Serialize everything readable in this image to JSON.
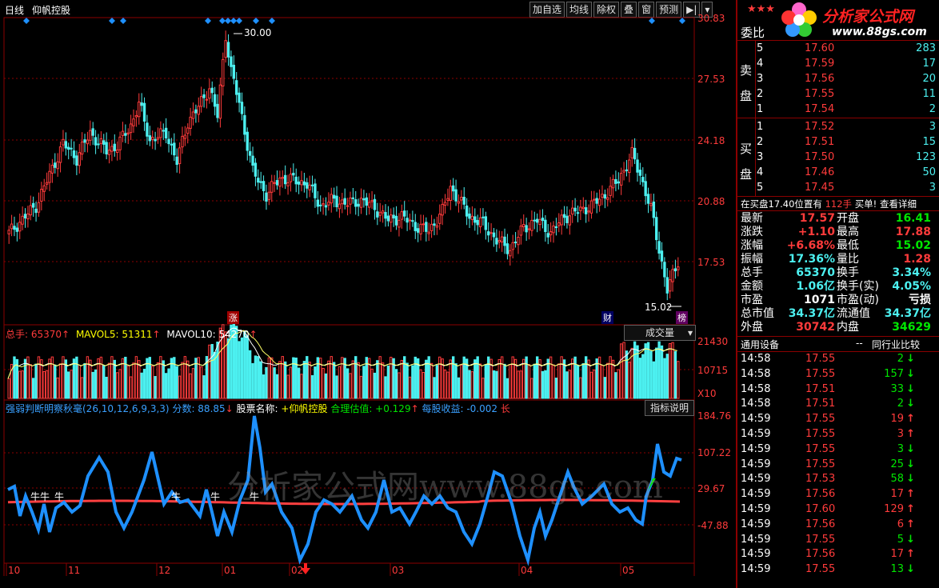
{
  "header": {
    "period_tab": "日线",
    "stock_name": "仰帆控股",
    "buttons": [
      "加自选",
      "均线",
      "除权",
      "叠",
      "窗",
      "预测"
    ],
    "brand_text": "分析家公式网",
    "brand_url": "www.88gs.com"
  },
  "price_chart": {
    "y_ticks": [
      "30.83",
      "27.53",
      "24.18",
      "20.88",
      "17.53"
    ],
    "high_label": "30.00",
    "low_label": "15.02",
    "markers": [
      "涨",
      "财",
      "榜"
    ]
  },
  "volume_panel": {
    "label_total": "总手: 65370",
    "label_ma5": "MAVOL5: 51311",
    "label_ma10": "MAVOL10: 54270",
    "dropdown": "成交量",
    "y_ticks": [
      "21430",
      "10715",
      "X10"
    ]
  },
  "indicator_panel": {
    "title": "强弱判断明察秋毫(26,10,12,6,9,3,3)",
    "score": "分数: 88.85",
    "stock_name_label": "股票名称:",
    "stock_name_value": "+仰帆控股",
    "fair_value": "合理估值: +0.129",
    "eps": "每股收益: -0.002",
    "suffix": "长",
    "button": "指标说明",
    "y_ticks": [
      "184.76",
      "107.22",
      "29.67",
      "-47.88"
    ],
    "watermark": "分析家公式网www.88gs.com",
    "niu_labels": [
      "牛牛",
      "牛",
      "牛",
      "牛",
      "牛"
    ]
  },
  "x_axis": [
    "10",
    "11",
    "12",
    "01",
    "02",
    "03",
    "04",
    "05"
  ],
  "order_book": {
    "title": "委比",
    "sell_label": "卖盘",
    "buy_label": "买盘",
    "sell": [
      {
        "level": "5",
        "price": "17.60",
        "vol": "283"
      },
      {
        "level": "4",
        "price": "17.59",
        "vol": "17"
      },
      {
        "level": "3",
        "price": "17.56",
        "vol": "20"
      },
      {
        "level": "2",
        "price": "17.55",
        "vol": "11"
      },
      {
        "level": "1",
        "price": "17.54",
        "vol": "2"
      }
    ],
    "buy": [
      {
        "level": "1",
        "price": "17.52",
        "vol": "3"
      },
      {
        "level": "2",
        "price": "17.51",
        "vol": "15"
      },
      {
        "level": "3",
        "price": "17.50",
        "vol": "123"
      },
      {
        "level": "4",
        "price": "17.46",
        "vol": "50"
      },
      {
        "level": "5",
        "price": "17.45",
        "vol": "3"
      }
    ],
    "notice_left": "在买盘17.40位置有",
    "notice_qty": "112手",
    "notice_right": "买单! 查看详细"
  },
  "quote": [
    {
      "l1": "最新",
      "v1": "17.57",
      "l2": "开盘",
      "v2": "16.41"
    },
    {
      "l1": "涨跌",
      "v1": "+1.10",
      "l2": "最高",
      "v2": "17.88"
    },
    {
      "l1": "涨幅",
      "v1": "+6.68%",
      "l2": "最低",
      "v2": "15.02"
    },
    {
      "l1": "振幅",
      "v1": "17.36%",
      "l2": "量比",
      "v2": "1.28"
    },
    {
      "l1": "总手",
      "v1": "65370",
      "l2": "换手",
      "v2": "3.34%"
    },
    {
      "l1": "金额",
      "v1": "1.06亿",
      "l2": "换手(实)",
      "v2": "4.05%"
    },
    {
      "l1": "市盈",
      "v1": "1071",
      "l2": "市盈(动)",
      "v2": "亏损"
    },
    {
      "l1": "总市值",
      "v1": "34.37亿",
      "l2": "流通值",
      "v2": "34.37亿"
    },
    {
      "l1": "外盘",
      "v1": "30742",
      "l2": "内盘",
      "v2": "34629"
    }
  ],
  "tabs": {
    "left": "通用设备",
    "dash": "--",
    "right": "同行业比较"
  },
  "ticks": [
    {
      "t": "14:58",
      "p": "17.55",
      "v": "2",
      "dir": "down"
    },
    {
      "t": "14:58",
      "p": "17.55",
      "v": "157",
      "dir": "down"
    },
    {
      "t": "14:58",
      "p": "17.51",
      "v": "33",
      "dir": "down"
    },
    {
      "t": "14:58",
      "p": "17.51",
      "v": "2",
      "dir": "down"
    },
    {
      "t": "14:59",
      "p": "17.55",
      "v": "19",
      "dir": "up"
    },
    {
      "t": "14:59",
      "p": "17.55",
      "v": "3",
      "dir": "up"
    },
    {
      "t": "14:59",
      "p": "17.55",
      "v": "3",
      "dir": "down"
    },
    {
      "t": "14:59",
      "p": "17.55",
      "v": "25",
      "dir": "down"
    },
    {
      "t": "14:59",
      "p": "17.53",
      "v": "58",
      "dir": "down"
    },
    {
      "t": "14:59",
      "p": "17.56",
      "v": "17",
      "dir": "up"
    },
    {
      "t": "14:59",
      "p": "17.60",
      "v": "129",
      "dir": "up"
    },
    {
      "t": "14:59",
      "p": "17.56",
      "v": "6",
      "dir": "up"
    },
    {
      "t": "14:59",
      "p": "17.55",
      "v": "5",
      "dir": "down"
    },
    {
      "t": "14:59",
      "p": "17.56",
      "v": "17",
      "dir": "up"
    },
    {
      "t": "14:59",
      "p": "17.55",
      "v": "13",
      "dir": "down"
    }
  ],
  "colors": {
    "up": "#ff3b3b",
    "down": "#4cf0f0",
    "grid": "#8b0000",
    "osc": "#1e90ff",
    "signal": "#ff4040"
  }
}
